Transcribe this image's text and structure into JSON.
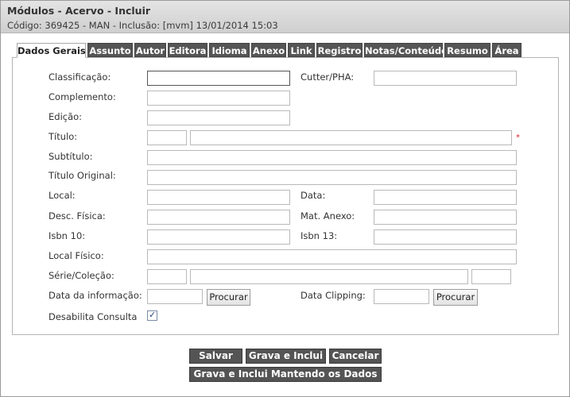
{
  "header": {
    "title": "Módulos - Acervo - Incluir",
    "subtitle": "Código: 369425 - MAN - Inclusão: [mvm] 13/01/2014 15:03"
  },
  "tabs": [
    {
      "label": "Dados Gerais",
      "active": true
    },
    {
      "label": "Assunto"
    },
    {
      "label": "Autor"
    },
    {
      "label": "Editora"
    },
    {
      "label": "Idioma"
    },
    {
      "label": "Anexo"
    },
    {
      "label": "Link"
    },
    {
      "label": "Registro"
    },
    {
      "label": "Notas/Conteúdo"
    },
    {
      "label": "Resumo"
    },
    {
      "label": "Área"
    }
  ],
  "form": {
    "classificacao": "Classificação:",
    "cutter": "Cutter/PHA:",
    "complemento": "Complemento:",
    "edicao": "Edição:",
    "titulo": "Título:",
    "required_mark": "*",
    "subtitulo": "Subtítulo:",
    "titulo_original": "Título Original:",
    "local": "Local:",
    "data": "Data:",
    "desc_fisica": "Desc. Física:",
    "mat_anexo": "Mat. Anexo:",
    "isbn10": "Isbn 10:",
    "isbn13": "Isbn 13:",
    "local_fisico": "Local Físico:",
    "serie_colecao": "Série/Coleção:",
    "data_informacao": "Data da informação:",
    "data_clipping": "Data Clipping:",
    "procurar": "Procurar",
    "desabilita_consulta": "Desabilita Consulta",
    "desabilita_checked": true
  },
  "actions": {
    "salvar": "Salvar",
    "grava_inclui": "Grava e Inclui",
    "cancelar": "Cancelar",
    "grava_inclui_mantendo": "Grava e Inclui Mantendo os Dados"
  },
  "colors": {
    "header_bg": "#d8d8d8",
    "tab_bg": "#555555",
    "button_bg": "#545454",
    "required": "#dd2222"
  }
}
